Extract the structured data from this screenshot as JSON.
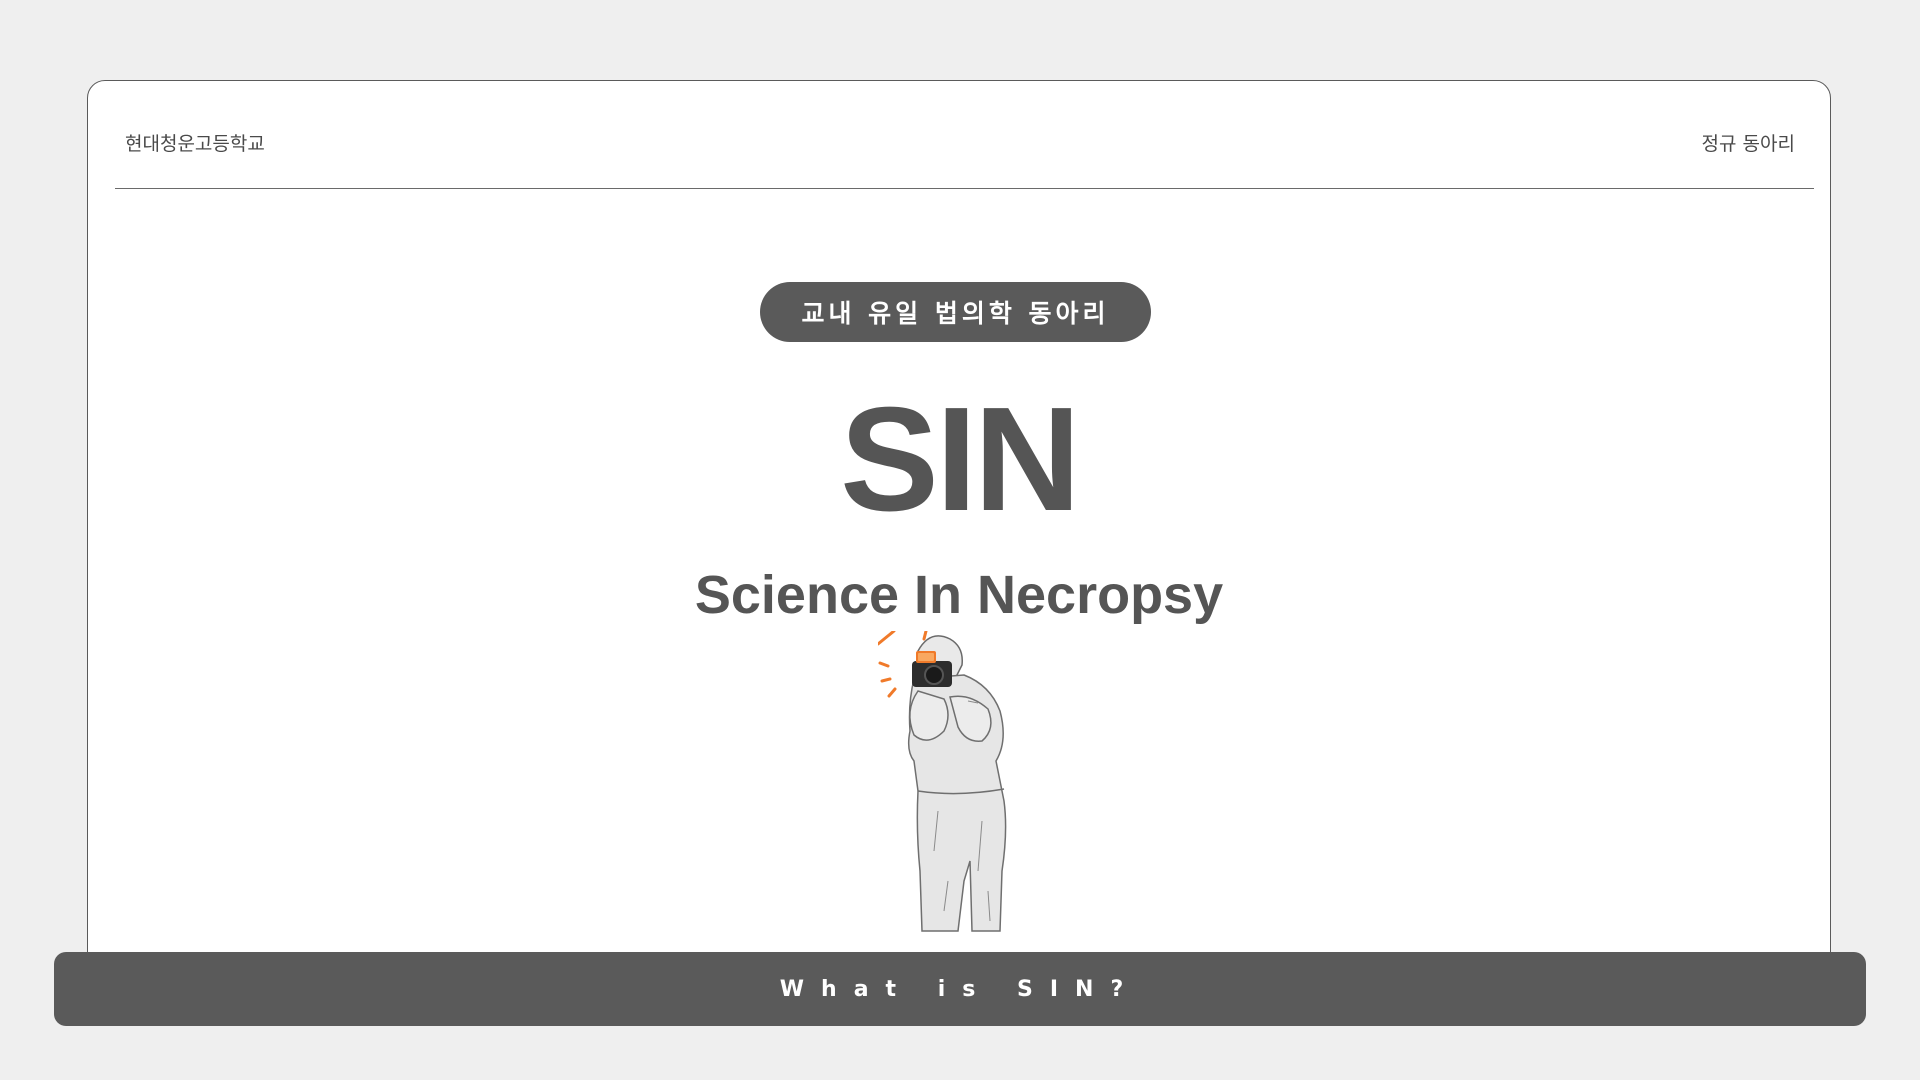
{
  "header": {
    "school_name": "현대청운고등학교",
    "club_type": "정규 동아리"
  },
  "hero": {
    "tagline": "교내 유일 법의학 동아리",
    "title": "SIN",
    "subtitle": "Science In Necropsy",
    "illustration": "forensic-photographer-illustration"
  },
  "footer": {
    "button_label": "What is SIN?"
  },
  "colors": {
    "background": "#efefef",
    "card": "#ffffff",
    "dark_gray": "#5a5a5a",
    "text_gray": "#555555",
    "accent_orange": "#f07a2a"
  }
}
